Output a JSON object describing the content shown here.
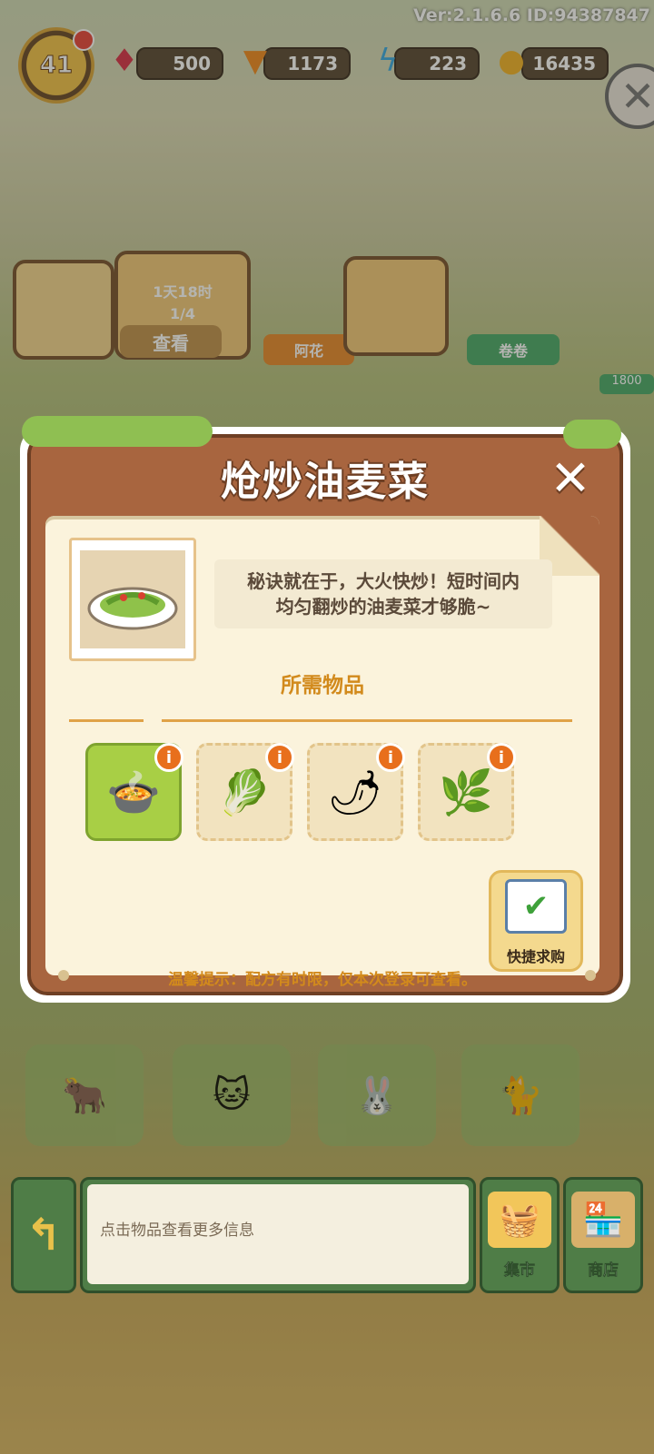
{
  "top_bar": {
    "version": "Ver:2.1.6.6 ID:94387847",
    "level": "41",
    "resources": [
      {
        "name": "gems",
        "icon": "gem-icon",
        "value": "500",
        "color": "#d8344a"
      },
      {
        "name": "carrots",
        "icon": "carrot-icon",
        "value": "1173",
        "color": "#f08a22"
      },
      {
        "name": "energy",
        "icon": "lightning-icon",
        "value": "223",
        "color": "#3aa8e0"
      },
      {
        "name": "coins",
        "icon": "coin-icon",
        "value": "16435",
        "color": "#f2b22a"
      }
    ]
  },
  "orders": {
    "timer": "1天18时",
    "progress": "1/4",
    "view_label": "查看",
    "customers": [
      {
        "name": "阿花",
        "tag_color": "#e68a2e"
      },
      {
        "name": "卷卷",
        "tag_color": "#4caa6a"
      }
    ],
    "partial_value": "1800"
  },
  "recipe_modal": {
    "title": "炝炒油麦菜",
    "description_line1": "秘诀就在于，大火快炒！短时间内",
    "description_line2": "均匀翻炒的油麦菜才够脆~",
    "required_title": "所需物品",
    "items": [
      {
        "name": "hot-pot-stove",
        "icon": "🍲",
        "active": true
      },
      {
        "name": "lettuce-tray",
        "icon": "🥬",
        "active": false
      },
      {
        "name": "red-chili",
        "icon": "🌶",
        "active": false
      },
      {
        "name": "green-peppercorn",
        "icon": "🌿",
        "active": false
      }
    ],
    "quick_buy_label": "快捷求购",
    "tip": "温馨提示：配方有时限，仅本次登录可查看。"
  },
  "bottom_bar": {
    "hint": "点击物品查看更多信息",
    "market_label": "集市",
    "shop_label": "商店"
  }
}
